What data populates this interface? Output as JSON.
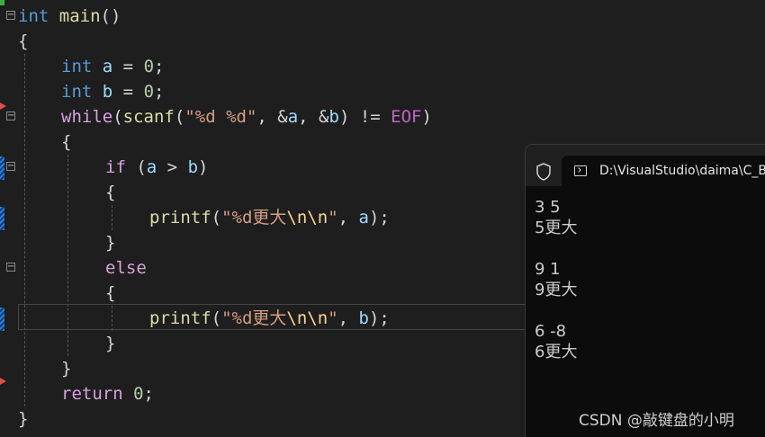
{
  "code": {
    "l1_type": "int",
    "l1_name": "main",
    "l1_parens": "()",
    "l2_brace": "{",
    "l3_type": "int",
    "l3_var": "a",
    "l3_op": " = ",
    "l3_num": "0",
    "l3_end": ";",
    "l4_type": "int",
    "l4_var": "b",
    "l4_op": " = ",
    "l4_num": "0",
    "l4_end": ";",
    "l5_kw": "while",
    "l5_p1": "(",
    "l5_fn": "scanf",
    "l5_p2": "(",
    "l5_str": "\"%d %d\"",
    "l5_comma": ", &",
    "l5_a": "a",
    "l5_comma2": ", &",
    "l5_b": "b",
    "l5_neq": ") != ",
    "l5_eof": "EOF",
    "l5_close": ")",
    "l6_brace": "{",
    "l7_kw": "if",
    "l7_p": " (",
    "l7_a": "a",
    "l7_gt": " > ",
    "l7_b": "b",
    "l7_close": ")",
    "l8_brace": "{",
    "l9_fn": "printf",
    "l9_p": "(",
    "l9_str1": "\"%d更大",
    "l9_esc": "\\n\\n",
    "l9_str2": "\"",
    "l9_comma": ", ",
    "l9_var": "a",
    "l9_end": ");",
    "l10_brace": "}",
    "l11_kw": "else",
    "l12_brace": "{",
    "l13_fn": "printf",
    "l13_p": "(",
    "l13_str1": "\"%d更大",
    "l13_esc": "\\n\\n",
    "l13_str2": "\"",
    "l13_comma": ", ",
    "l13_var": "b",
    "l13_end": ");",
    "l14_brace": "}",
    "l15_brace": "}",
    "l16_kw": "return",
    "l16_num": "0",
    "l16_end": ";",
    "l17_brace": "}",
    "fold_symbol": "−"
  },
  "terminal": {
    "tab_title": "D:\\VisualStudio\\daima\\C_B",
    "output_lines": [
      "3 5",
      "5更大",
      "",
      "9 1",
      "9更大",
      "",
      "6 -8",
      "6更大"
    ]
  },
  "watermark": "CSDN @敲键盘的小明",
  "icons": {
    "fold": "collapse-icon",
    "shield": "shield-icon",
    "terminal": "terminal-icon"
  }
}
